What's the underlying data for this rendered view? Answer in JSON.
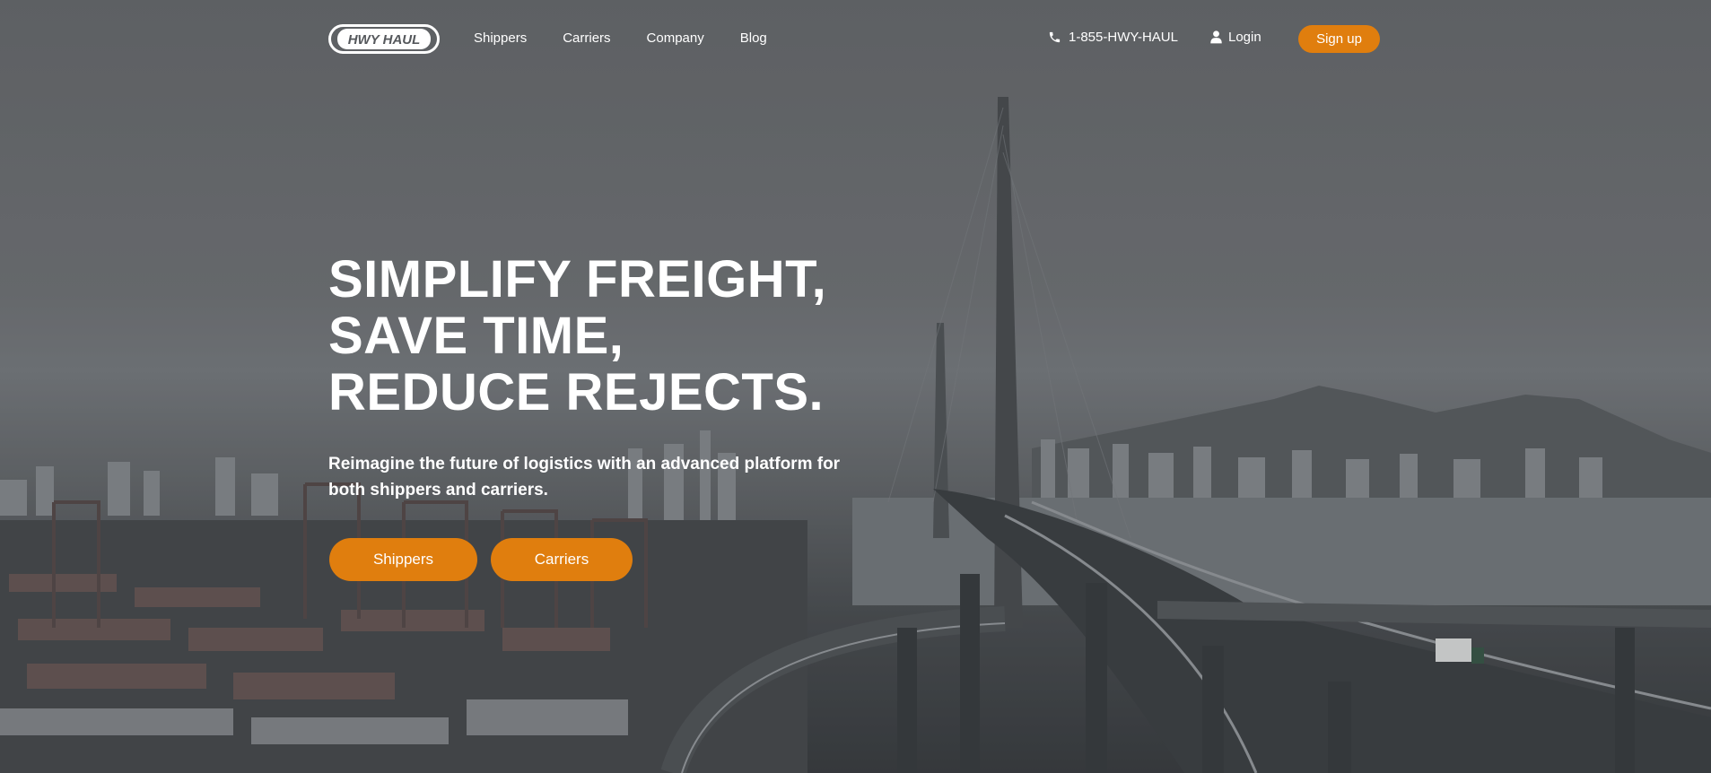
{
  "brand": {
    "logo_text": "HWY HAUL"
  },
  "nav": {
    "links": [
      {
        "label": "Shippers"
      },
      {
        "label": "Carriers"
      },
      {
        "label": "Company"
      },
      {
        "label": "Blog"
      }
    ],
    "phone": "1-855-HWY-HAUL",
    "login": "Login",
    "signup": "Sign up"
  },
  "hero": {
    "title_lines": [
      "SIMPLIFY FREIGHT,",
      "SAVE TIME,",
      "REDUCE REJECTS."
    ],
    "subtitle": "Reimagine the future of logistics with an advanced platform for both shippers and carriers.",
    "buttons": {
      "shippers": "Shippers",
      "carriers": "Carriers"
    }
  },
  "colors": {
    "accent": "#e07e0e",
    "text": "#ffffff"
  },
  "icons": {
    "phone": "phone-icon",
    "login": "user-icon"
  }
}
